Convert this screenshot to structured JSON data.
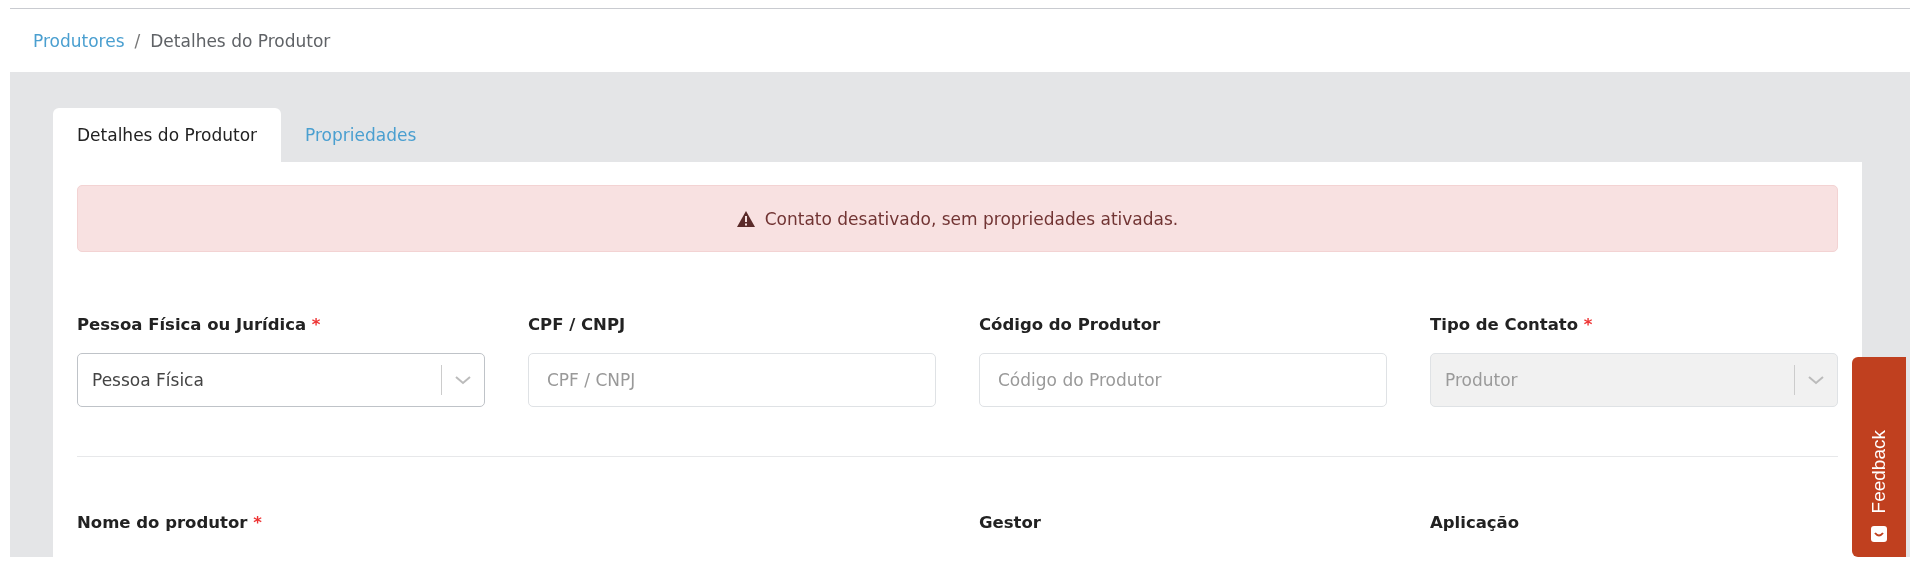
{
  "breadcrumb": [
    {
      "label": "Produtores",
      "kind": "link"
    },
    {
      "separator": "/",
      "label": "Detalhes do Produtor",
      "kind": "current"
    }
  ],
  "tabs": [
    {
      "label": "Detalhes do Produtor",
      "selected": true
    },
    {
      "label": "Propriedades",
      "selected": false
    }
  ],
  "alert": {
    "text": "Contato desativado, sem propriedades ativadas."
  },
  "fields": [
    {
      "label": "Pessoa Física ou Jurídica",
      "required_mark": "*",
      "kind": "select",
      "value": "Pessoa Física",
      "disabled": false
    },
    {
      "label": "CPF / CNPJ",
      "kind": "input",
      "placeholder": "CPF / CNPJ",
      "disabled": false
    },
    {
      "label": "Código do Produtor",
      "kind": "input",
      "placeholder": "Código do Produtor",
      "disabled": false
    },
    {
      "label": "Tipo de Contato",
      "required_mark": "*",
      "kind": "select",
      "value": "Produtor",
      "disabled": true
    }
  ],
  "second_row": [
    {
      "label": "Nome do produtor",
      "required_mark": "*"
    },
    {
      "label": "Gestor"
    },
    {
      "label": "Aplicação"
    }
  ],
  "feedback": {
    "label": "Feedback"
  }
}
